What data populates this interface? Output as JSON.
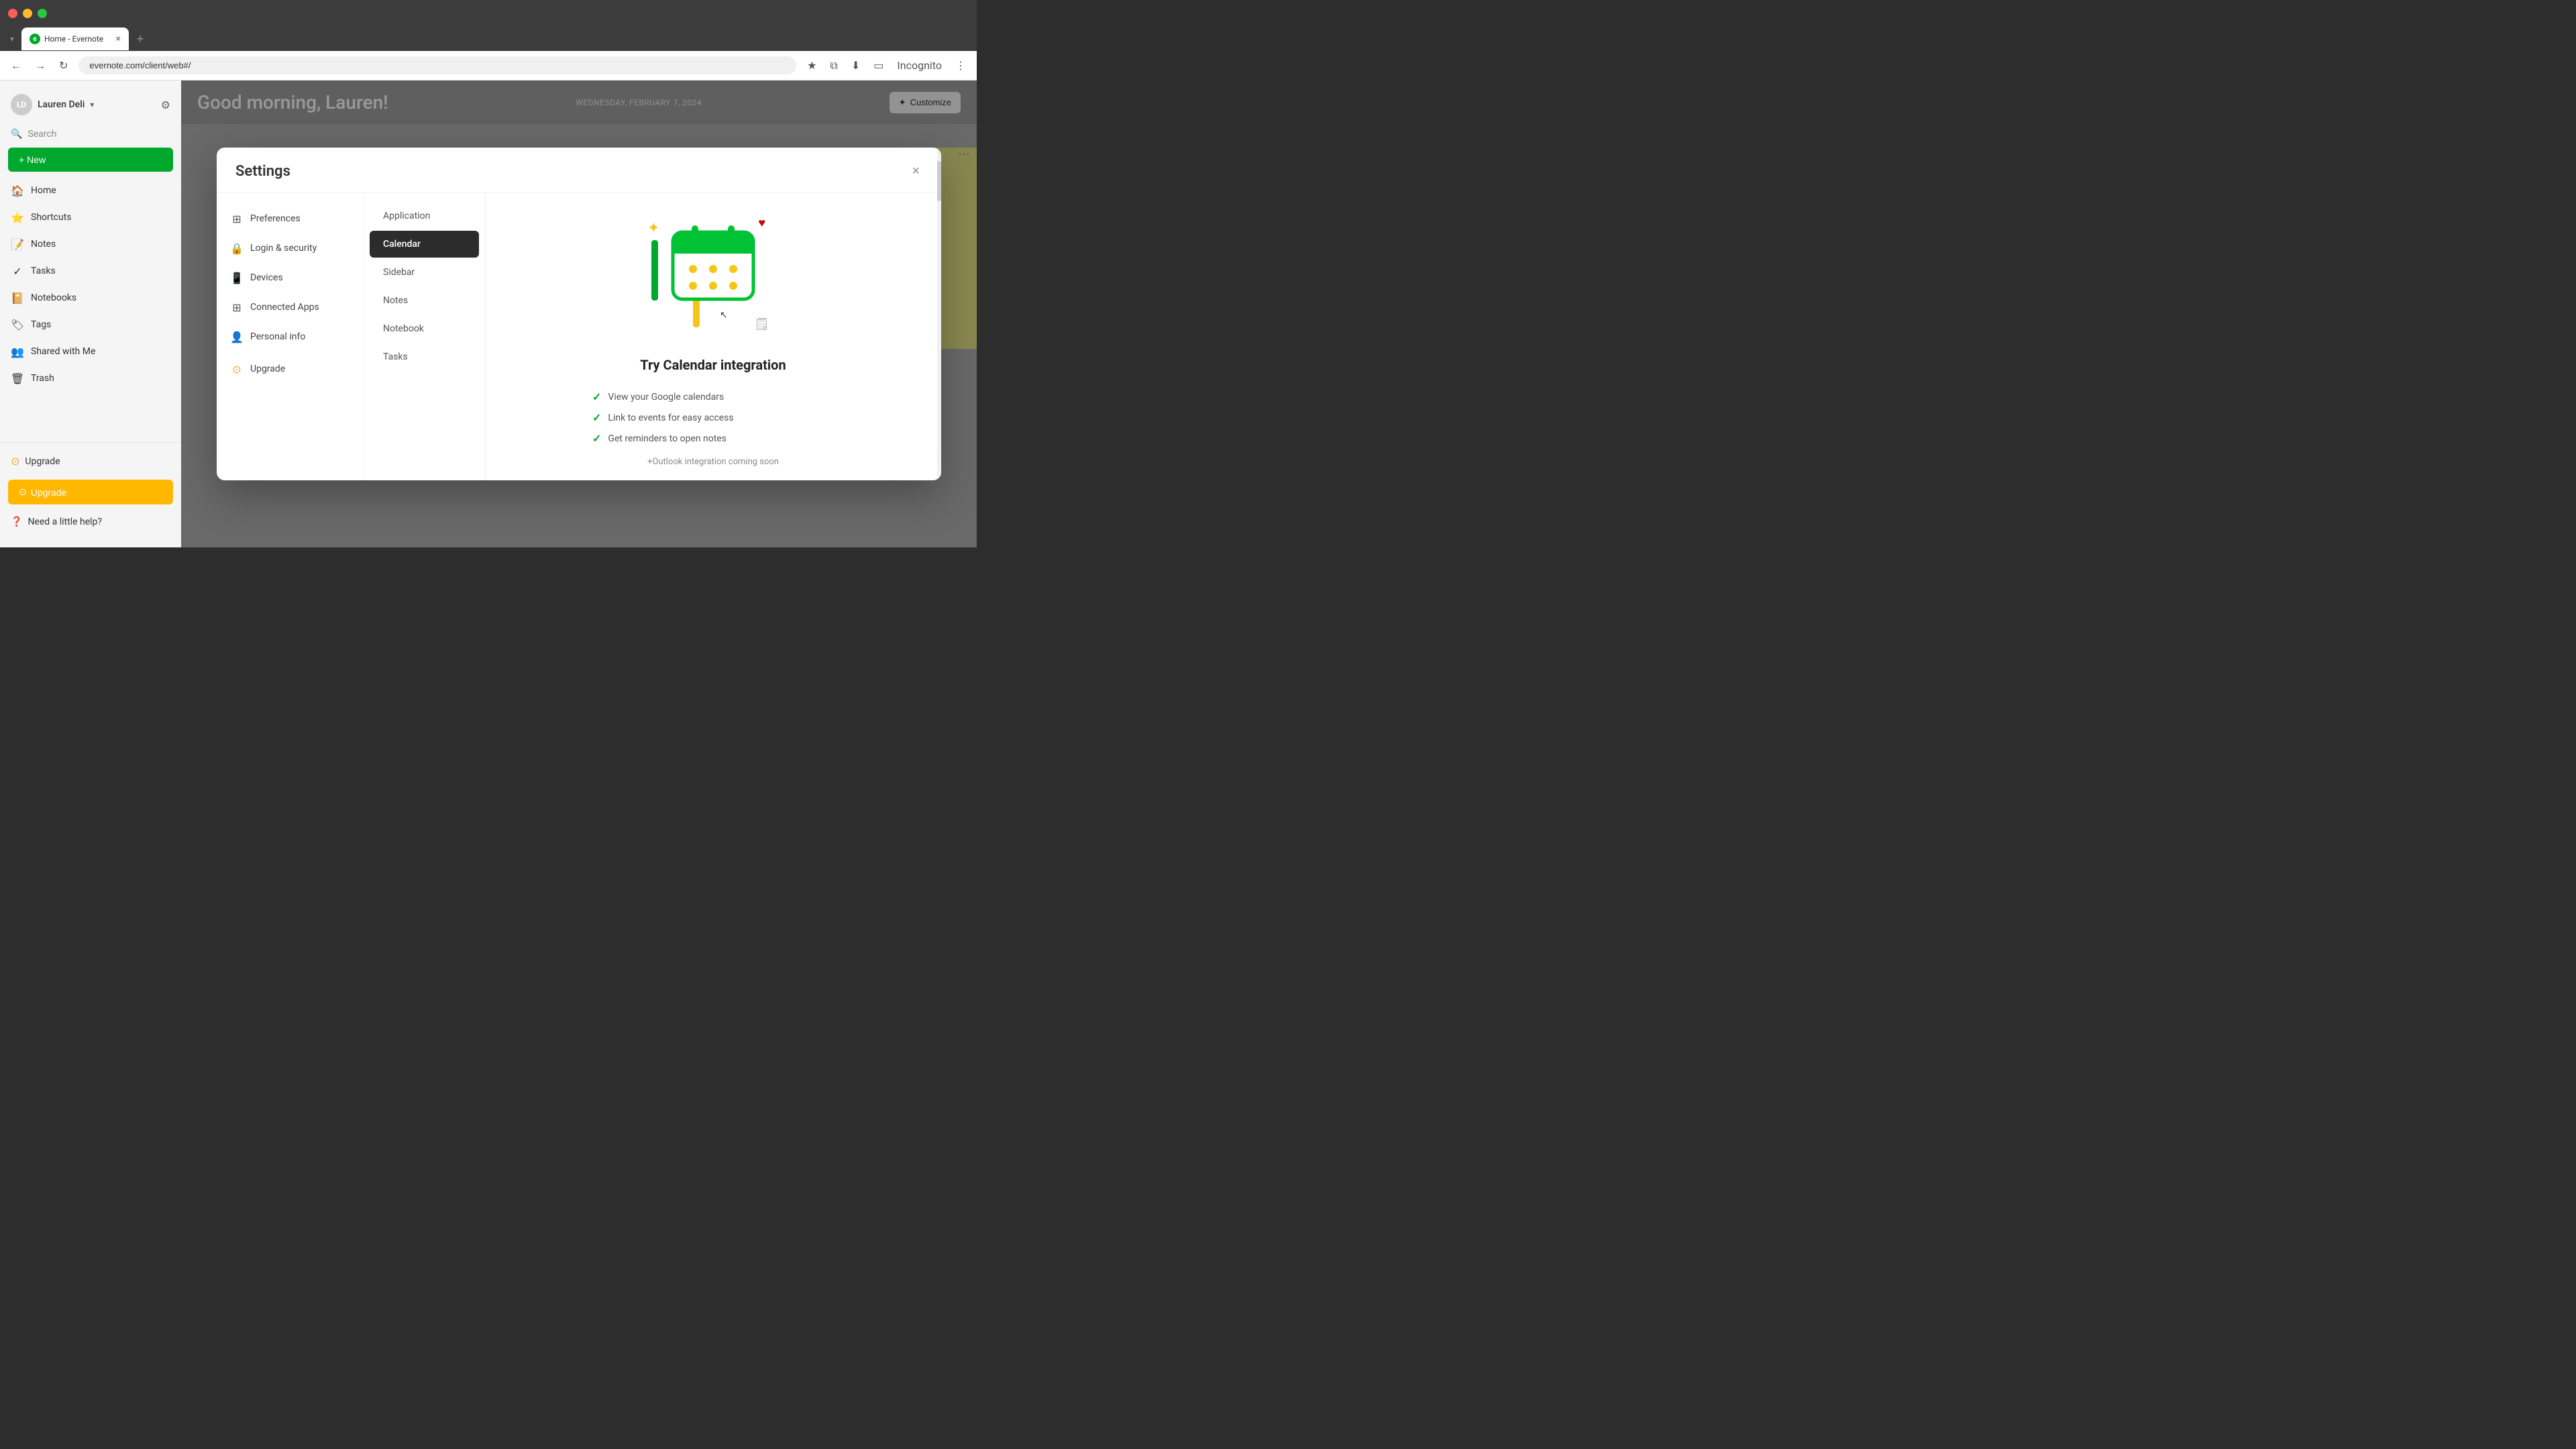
{
  "browser": {
    "tab_title": "Home - Evernote",
    "tab_favicon_letter": "E",
    "url": "evernote.com/client/web#/",
    "new_tab_icon": "+",
    "tab_close": "×",
    "nav_back": "←",
    "nav_forward": "→",
    "nav_reload": "↻",
    "toolbar": {
      "bookmark_icon": "★",
      "extensions_icon": "⧉",
      "download_icon": "⬇",
      "layout_icon": "▭",
      "incognito_label": "Incognito",
      "more_icon": "⋮"
    }
  },
  "sidebar": {
    "user_name": "Lauren Deli",
    "user_initials": "LD",
    "user_chevron": "▾",
    "gear_icon": "⚙",
    "search_label": "Search",
    "new_button_label": "+ New",
    "nav_items": [
      {
        "id": "home",
        "label": "Home",
        "icon": "🏠"
      },
      {
        "id": "shortcuts",
        "label": "Shortcuts",
        "icon": "⭐"
      },
      {
        "id": "notes",
        "label": "Notes",
        "icon": "📝"
      },
      {
        "id": "tasks",
        "label": "Tasks",
        "icon": "✓"
      },
      {
        "id": "notebooks",
        "label": "Notebooks",
        "icon": "📔"
      },
      {
        "id": "tags",
        "label": "Tags",
        "icon": "🏷"
      },
      {
        "id": "shared",
        "label": "Shared with Me",
        "icon": "👥"
      },
      {
        "id": "trash",
        "label": "Trash",
        "icon": "🗑"
      }
    ],
    "upgrade_label": "Upgrade",
    "upgrade_icon": "⊙",
    "help_label": "Need a little help?",
    "help_icon": "?",
    "upgrade_bar_label": "Upgrade"
  },
  "main": {
    "greeting": "Good morning, Lauren!",
    "date": "WEDNESDAY, FEBRUARY 7, 2024",
    "customize_label": "Customize",
    "customize_icon": "✦"
  },
  "settings_dialog": {
    "title": "Settings",
    "close_icon": "×",
    "left_nav": [
      {
        "id": "preferences",
        "label": "Preferences",
        "icon": "⊞"
      },
      {
        "id": "login-security",
        "label": "Login & security",
        "icon": "🔒"
      },
      {
        "id": "devices",
        "label": "Devices",
        "icon": "📱"
      },
      {
        "id": "connected-apps",
        "label": "Connected Apps",
        "icon": "⊞"
      },
      {
        "id": "personal-info",
        "label": "Personal info",
        "icon": "👤"
      }
    ],
    "upgrade_item_label": "Upgrade",
    "upgrade_item_icon": "⊙",
    "sub_nav": [
      {
        "id": "application",
        "label": "Application",
        "active": false
      },
      {
        "id": "calendar",
        "label": "Calendar",
        "active": true
      },
      {
        "id": "sidebar",
        "label": "Sidebar",
        "active": false
      },
      {
        "id": "notes",
        "label": "Notes",
        "active": false
      },
      {
        "id": "notebook",
        "label": "Notebook",
        "active": false
      },
      {
        "id": "tasks",
        "label": "Tasks",
        "active": false
      }
    ],
    "content": {
      "section_title": "Try Calendar integration",
      "features": [
        "View your Google calendars",
        "Link to events for easy access",
        "Get reminders to open notes"
      ],
      "coming_soon": "+Outlook integration coming soon"
    }
  }
}
